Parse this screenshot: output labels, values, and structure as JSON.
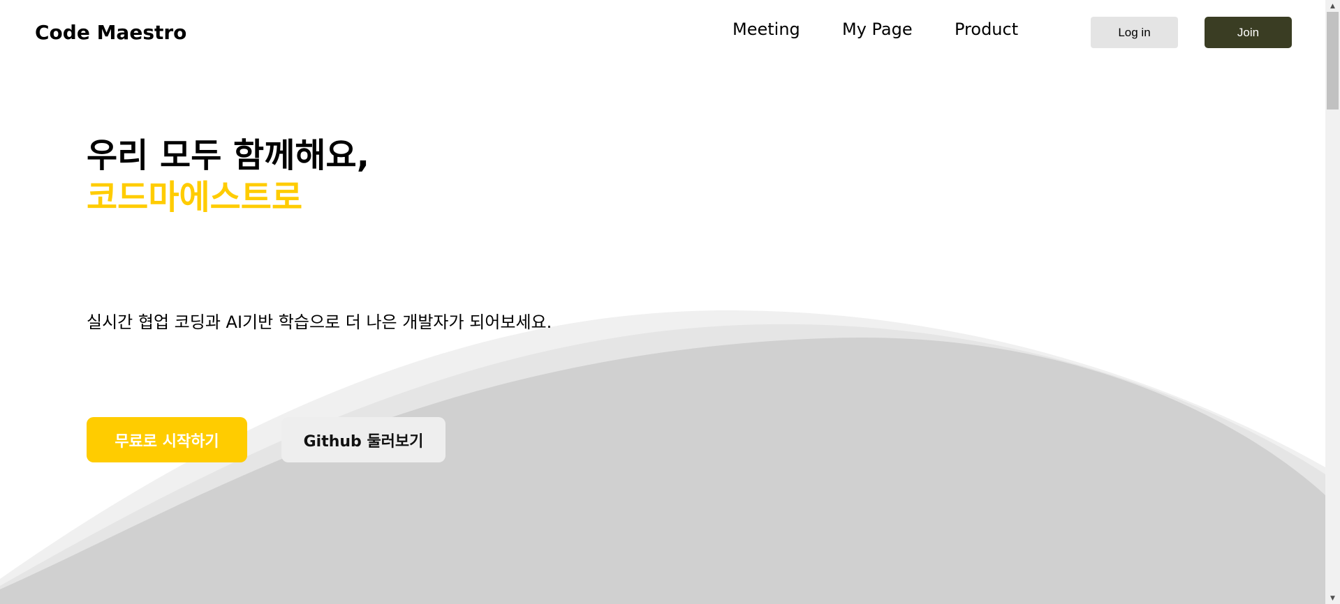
{
  "header": {
    "logo": "Code Maestro",
    "nav": {
      "meeting": "Meeting",
      "my_page": "My Page",
      "product": "Product"
    },
    "login_label": "Log in",
    "join_label": "Join"
  },
  "hero": {
    "title_line1": "우리 모두 함께해요,",
    "title_line2": "코드마에스트로",
    "subtitle": "실시간 협업 코딩과 AI기반 학습으로 더 나은 개발자가 되어보세요.",
    "start_button": "무료로 시작하기",
    "github_button": "Github 둘러보기"
  },
  "scrollbar": {
    "up_icon": "▲",
    "down_icon": "▼"
  },
  "colors": {
    "accent": "#ffcc00",
    "join_bg": "#3a3d23",
    "curve_light": "#f0f0f0",
    "curve_mid": "#e5e5e5",
    "curve_dark": "#d0d0d0"
  }
}
